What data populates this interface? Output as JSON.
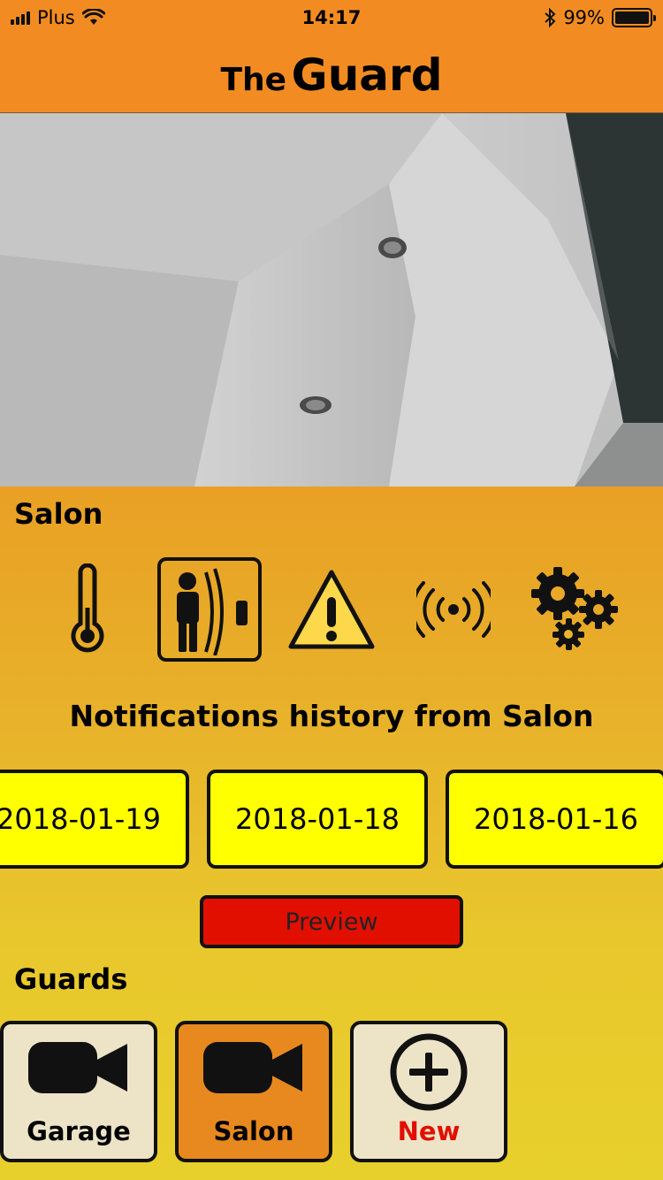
{
  "status_bar": {
    "carrier": "Plus",
    "time": "14:17",
    "battery_percent": "99%",
    "battery_level": 0.99,
    "icons": [
      "signal-icon",
      "wifi-icon",
      "bluetooth-icon",
      "battery-icon"
    ]
  },
  "header": {
    "title_part1": "The",
    "title_part2": "Guard",
    "background_color": "#f28c22"
  },
  "camera": {
    "feed_icon": "camera-feed-image"
  },
  "room": {
    "name": "Salon",
    "controls": [
      {
        "icon": "thermometer-icon",
        "selected": false
      },
      {
        "icon": "motion-sensor-icon",
        "selected": true
      },
      {
        "icon": "warning-icon",
        "selected": false
      },
      {
        "icon": "broadcast-icon",
        "selected": false
      },
      {
        "icon": "settings-gears-icon",
        "selected": false
      }
    ]
  },
  "notifications": {
    "title": "Notifications history from Salon",
    "dates": [
      "2018-01-19",
      "2018-01-18",
      "2018-01-16"
    ],
    "preview_label": "Preview"
  },
  "guards": {
    "label": "Guards",
    "items": [
      {
        "label": "Garage",
        "icon": "video-camera-icon",
        "active": false
      },
      {
        "label": "Salon",
        "icon": "video-camera-icon",
        "active": true
      },
      {
        "label": "New",
        "icon": "add-circle-icon",
        "active": false
      }
    ]
  },
  "colors": {
    "accent_orange": "#f28c22",
    "date_yellow": "#ffff00",
    "preview_red": "#e10f00",
    "new_label_red": "#e10f00",
    "tile_beige": "#ede4c8",
    "tile_active": "#e8891f"
  }
}
